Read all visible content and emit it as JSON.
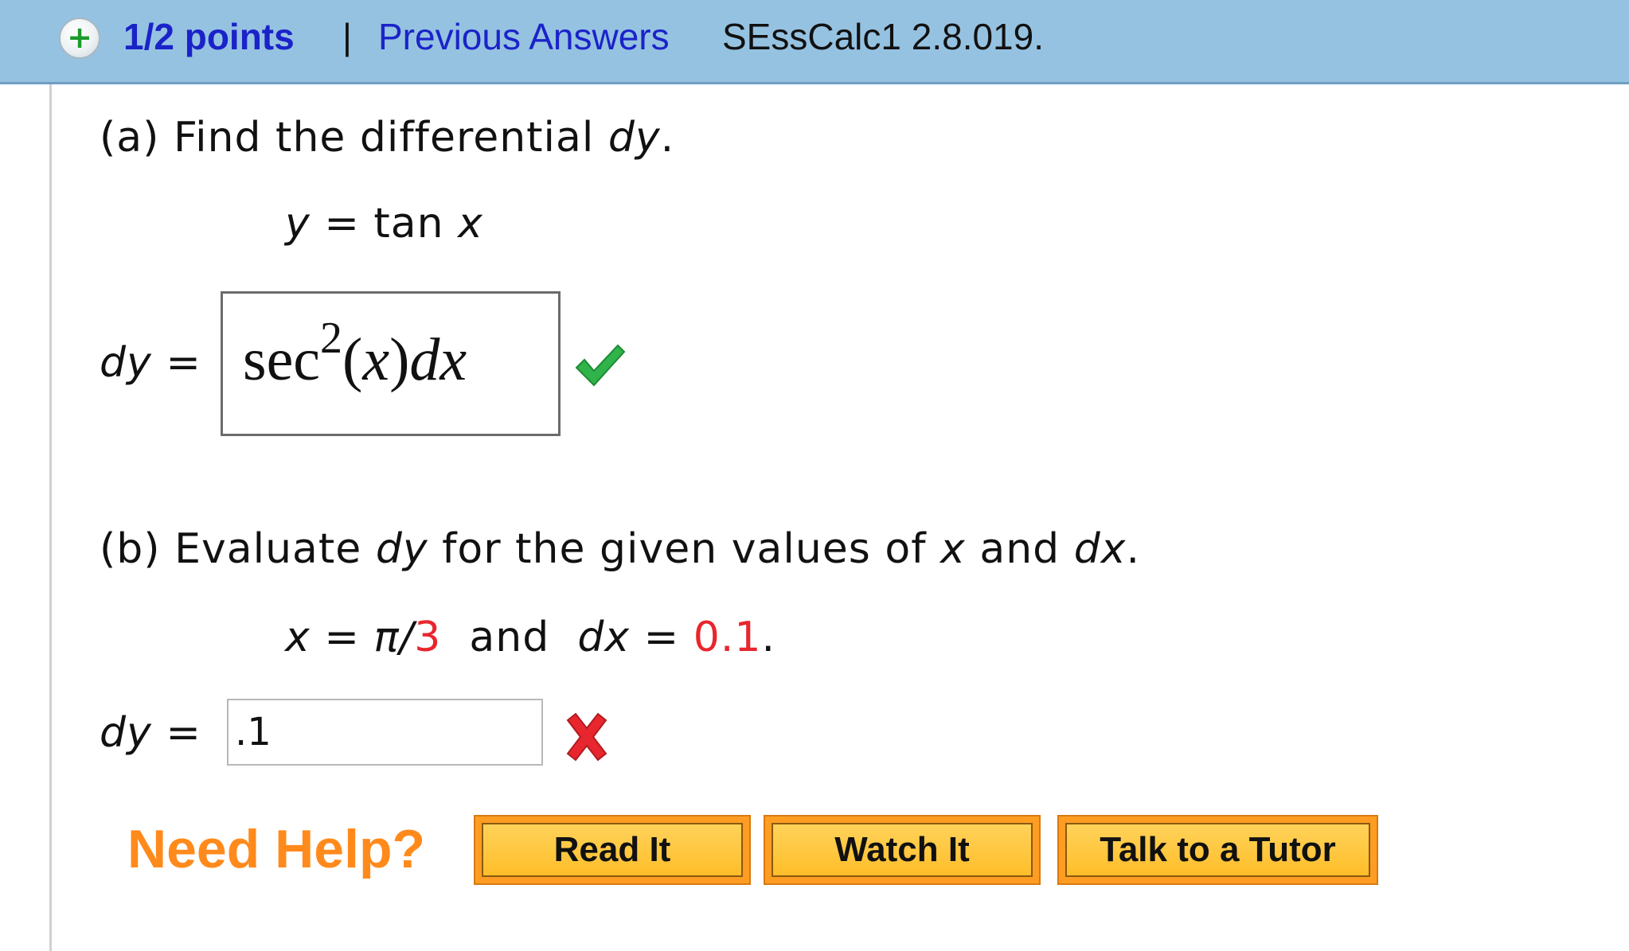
{
  "header": {
    "expand_icon": "plus-circle-icon",
    "points": "1/2 points",
    "separator": "|",
    "previous_answers": "Previous Answers",
    "question_id": "SEssCalc1 2.8.019."
  },
  "part_a": {
    "label": "(a)",
    "prompt_text": "Find the differential",
    "prompt_var": "dy",
    "period": ".",
    "equation_lhs": "y",
    "equation_eq": "=",
    "equation_fn": "tan",
    "equation_var": "x",
    "answer_label": "dy",
    "answer_eq": "=",
    "answer": {
      "func": "sec",
      "exponent": "2",
      "open": "(",
      "arg": "x",
      "close": ")",
      "diff": "dx"
    },
    "status_icon": "check-icon",
    "status_color": "#2fb34a"
  },
  "part_b": {
    "label": "(b)",
    "prompt_1": "Evaluate",
    "prompt_var1": "dy",
    "prompt_2": "for the given values of",
    "prompt_var2": "x",
    "prompt_3": "and",
    "prompt_var3": "dx",
    "prompt_end": ".",
    "given_x": "x",
    "given_eq1": "=",
    "given_pi": "π/",
    "given_x_val": "3",
    "given_and": "and",
    "given_dx": "dx",
    "given_eq2": "=",
    "given_dx_val": "0.1",
    "given_end": ".",
    "answer_label": "dy",
    "answer_eq": "=",
    "answer_value": ".1",
    "status_icon": "cross-icon",
    "status_color": "#e8262d"
  },
  "help": {
    "label": "Need Help?",
    "buttons": [
      "Read It",
      "Watch It",
      "Talk to a Tutor"
    ],
    "label_color": "#ff8a1c"
  }
}
